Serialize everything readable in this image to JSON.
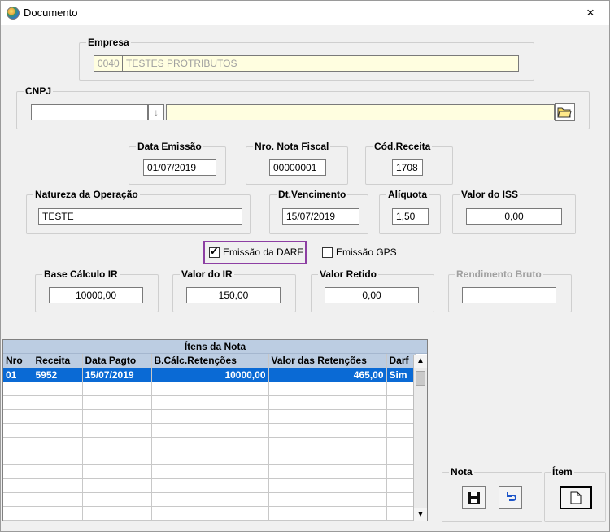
{
  "window": {
    "title": "Documento",
    "close_icon": "×"
  },
  "empresa": {
    "legend": "Empresa",
    "code": "0040",
    "name": "TESTES PROTRIBUTOS"
  },
  "cnpj": {
    "legend": "CNPJ",
    "value": "",
    "description": ""
  },
  "data_emissao": {
    "legend": "Data Emissão",
    "value": "01/07/2019"
  },
  "nro_nota": {
    "legend": "Nro. Nota Fiscal",
    "value": "00000001"
  },
  "cod_receita": {
    "legend": "Cód.Receita",
    "value": "1708"
  },
  "natureza": {
    "legend": "Natureza da Operação",
    "value": "TESTE"
  },
  "dt_vencimento": {
    "legend": "Dt.Vencimento",
    "value": "15/07/2019"
  },
  "aliquota": {
    "legend": "Alíquota",
    "value": "1,50"
  },
  "valor_iss": {
    "legend": "Valor do ISS",
    "value": "0,00"
  },
  "checks": {
    "darf": {
      "label": "Emissão da DARF",
      "checked": true
    },
    "gps": {
      "label": "Emissão GPS",
      "checked": false
    }
  },
  "base_ir": {
    "legend": "Base Cálculo IR",
    "value": "10000,00"
  },
  "valor_ir": {
    "legend": "Valor do IR",
    "value": "150,00"
  },
  "valor_retido": {
    "legend": "Valor Retido",
    "value": "0,00"
  },
  "rendimento_bruto": {
    "legend": "Rendimento Bruto",
    "value": ""
  },
  "itens": {
    "title": "Ítens da Nota",
    "columns": [
      "Nro",
      "Receita",
      "Data Pagto",
      "B.Cálc.Retenções",
      "Valor das Retenções",
      "Darf"
    ],
    "rows": [
      [
        "01",
        "5952",
        "15/07/2019",
        "10000,00",
        "465,00",
        "Sim"
      ]
    ]
  },
  "nota": {
    "legend": "Nota"
  },
  "item": {
    "legend": "Ítem"
  },
  "colors": {
    "selected_row": "#0a6ad5",
    "highlight": "#8d3fa3",
    "input_yellow": "#fffee0"
  }
}
